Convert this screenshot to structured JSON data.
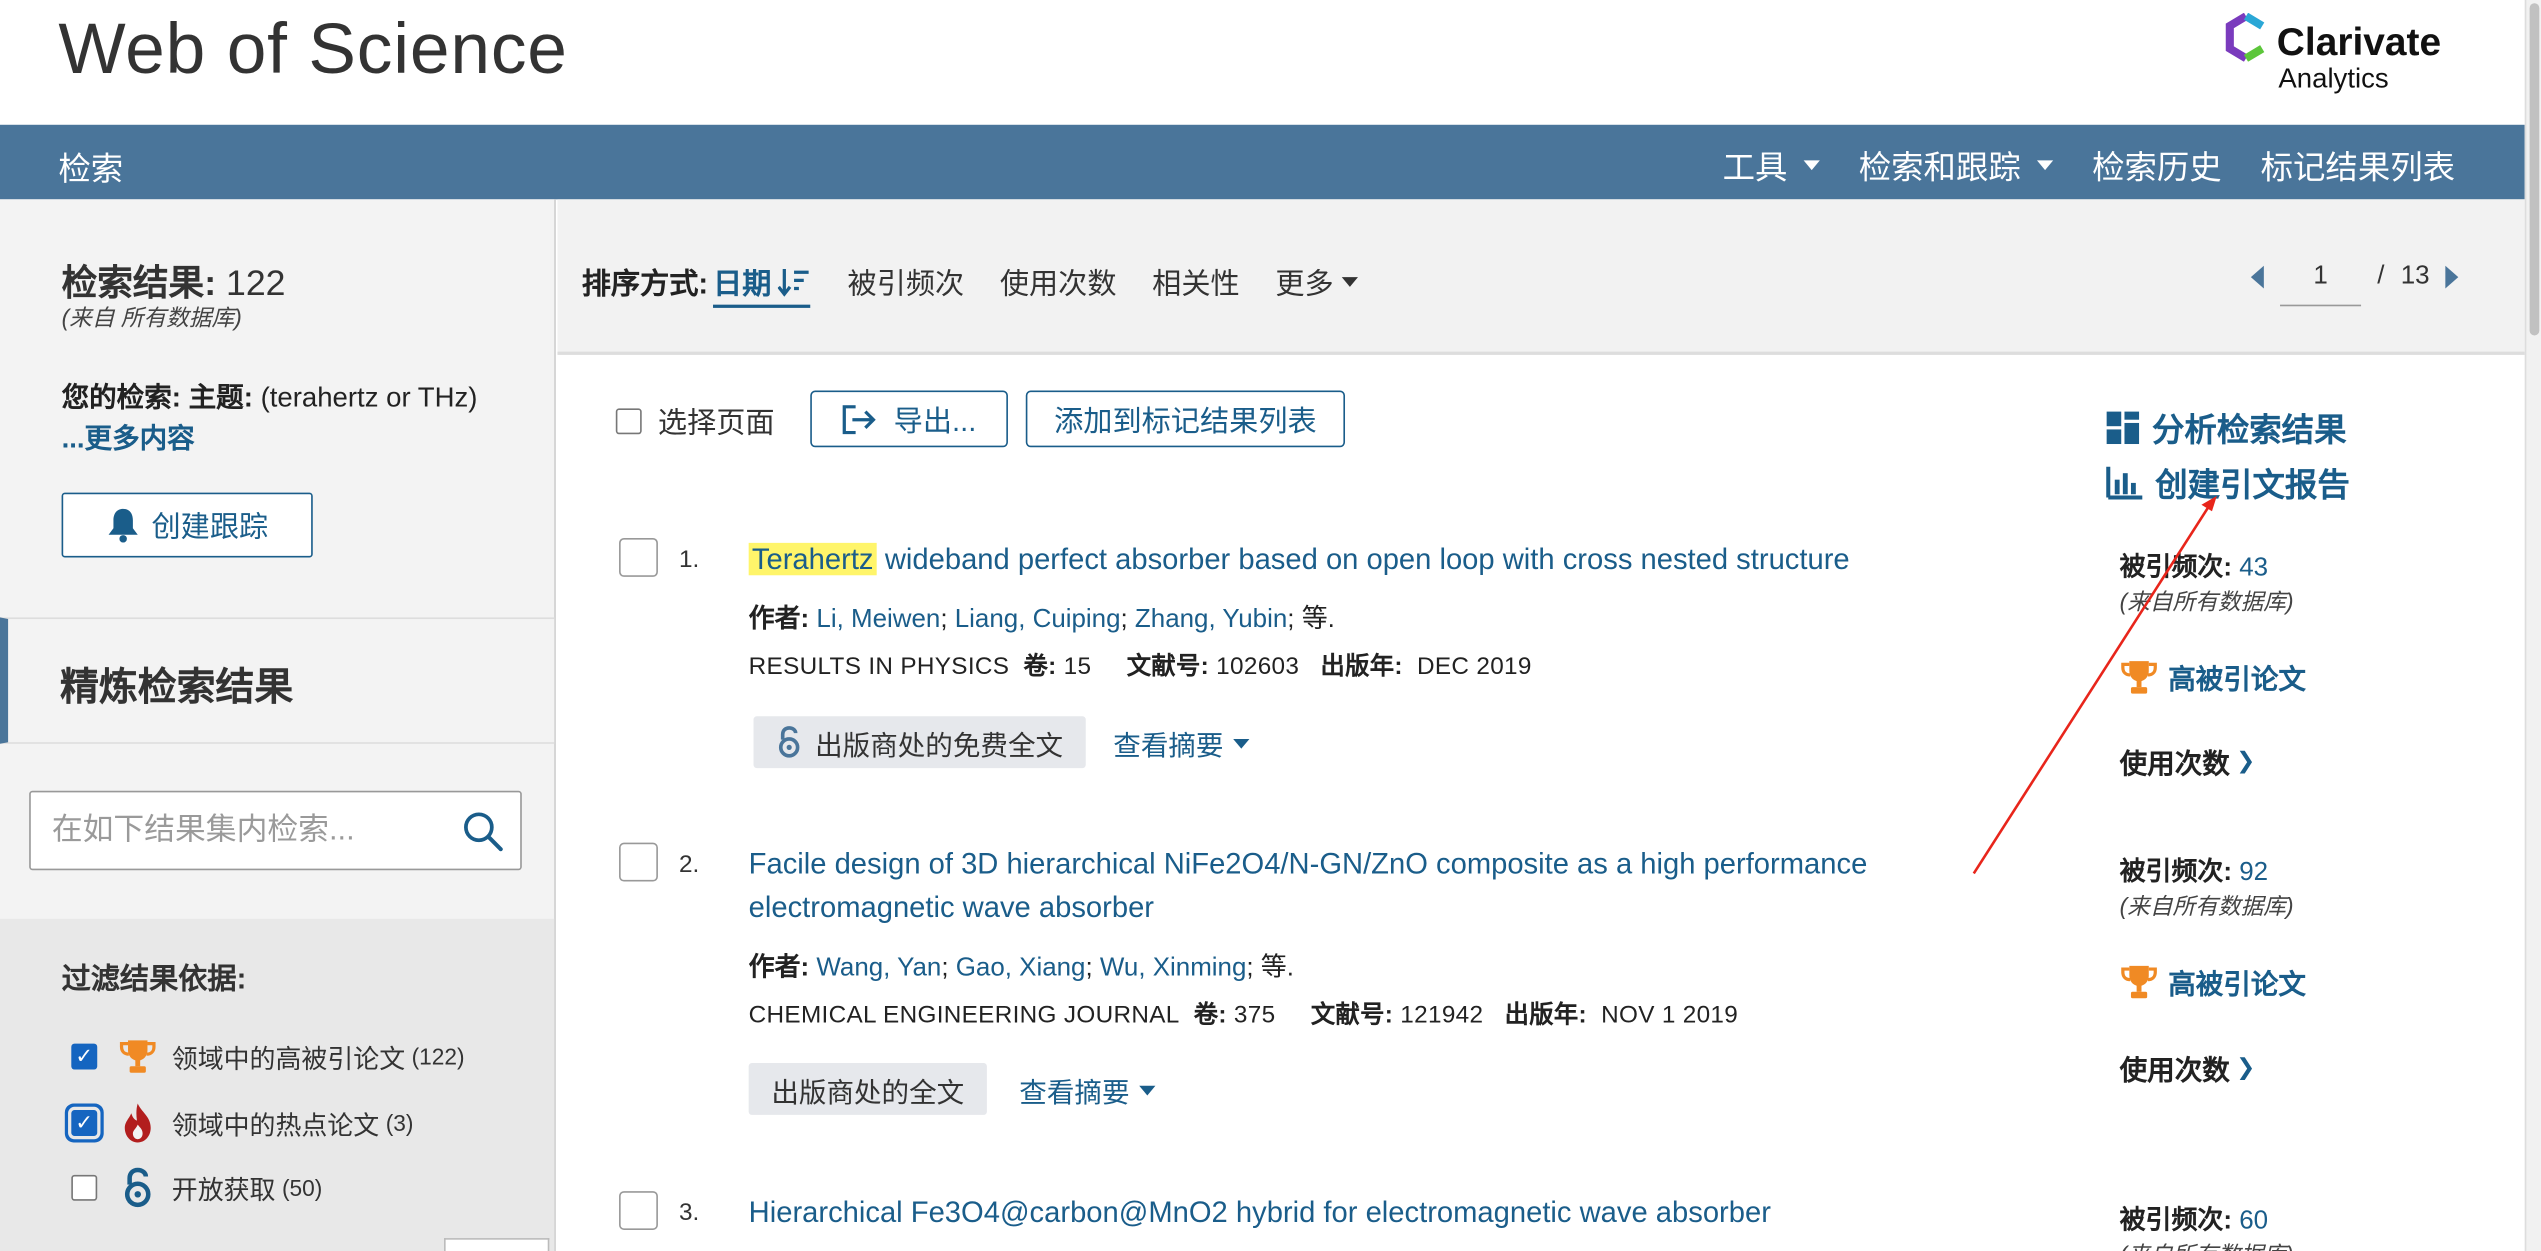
{
  "header": {
    "title": "Web of Science",
    "logo": {
      "name": "Clarivate",
      "sub": "Analytics"
    }
  },
  "nav": {
    "left": "检索",
    "items": [
      {
        "label": "工具",
        "dropdown": true
      },
      {
        "label": "检索和跟踪",
        "dropdown": true
      },
      {
        "label": "检索历史",
        "dropdown": false
      },
      {
        "label": "标记结果列表",
        "dropdown": false
      }
    ]
  },
  "sidebar": {
    "results_label": "检索结果",
    "results_sep": ": ",
    "results_count": "122",
    "results_source": "(来自 所有数据库)",
    "your_search_label": "您的检索:",
    "topic_label": "主题:",
    "query": "(terahertz or THz)",
    "more_link": "...更多内容",
    "create_alert": "创建跟踪",
    "refine_title": "精炼检索结果",
    "search_within_placeholder": "在如下结果集内检索...",
    "filter_title": "过滤结果依据:",
    "filters": [
      {
        "label": "领域中的高被引论文",
        "count": "(122)",
        "checked": true,
        "icon": "trophy-icon"
      },
      {
        "label": "领域中的热点论文",
        "count": "(3)",
        "checked": true,
        "icon": "flame-icon"
      },
      {
        "label": "开放获取",
        "count": "(50)",
        "checked": false,
        "icon": "open-access-icon"
      }
    ]
  },
  "sort": {
    "label": "排序方式:",
    "active": "日期",
    "options": [
      "被引频次",
      "使用次数",
      "相关性"
    ],
    "more": "更多"
  },
  "pager": {
    "current": "1",
    "separator": "/",
    "total": "13"
  },
  "toolbar": {
    "select_page": "选择页面",
    "export": "导出...",
    "add_marked": "添加到标记结果列表",
    "analyze": "分析检索结果",
    "citation_report": "创建引文报告"
  },
  "labels": {
    "author": "作者:",
    "volume": "卷:",
    "article_no": "文献号:",
    "year": "出版年:",
    "cited": "被引频次:",
    "cited_src": "(来自所有数据库)",
    "highly_cited": "高被引论文",
    "usage": "使用次数",
    "abstract": "查看摘要"
  },
  "records": [
    {
      "num": "1.",
      "title_hl": "Terahertz",
      "title_rest": " wideband perfect absorber based on open loop with cross nested structure",
      "authors": [
        "Li, Meiwen",
        "Liang, Cuiping",
        "Zhang, Yubin"
      ],
      "etal": "等.",
      "journal": "RESULTS IN PHYSICS",
      "volume": "15",
      "article_no": "102603",
      "year": "DEC 2019",
      "fulltext": "出版商处的免费全文",
      "fulltext_icon": "open-access-icon",
      "cited": "43"
    },
    {
      "num": "2.",
      "title_hl": "",
      "title_rest": "Facile design of 3D hierarchical NiFe2O4/N-GN/ZnO composite as a high performance electromagnetic wave absorber",
      "authors": [
        "Wang, Yan",
        "Gao, Xiang",
        "Wu, Xinming"
      ],
      "etal": "等.",
      "journal": "CHEMICAL ENGINEERING JOURNAL",
      "volume": "375",
      "article_no": "121942",
      "year": "NOV 1 2019",
      "fulltext": "出版商处的全文",
      "fulltext_icon": "",
      "cited": "92"
    },
    {
      "num": "3.",
      "title_hl": "",
      "title_rest": "Hierarchical Fe3O4@carbon@MnO2 hybrid for electromagnetic wave absorber",
      "cited": "60"
    }
  ],
  "colors": {
    "nav_bg": "#4a759a",
    "link": "#1a5d8a",
    "highlight": "#fff56a",
    "trophy": "#f08a24",
    "annotation": "#e8251b"
  }
}
